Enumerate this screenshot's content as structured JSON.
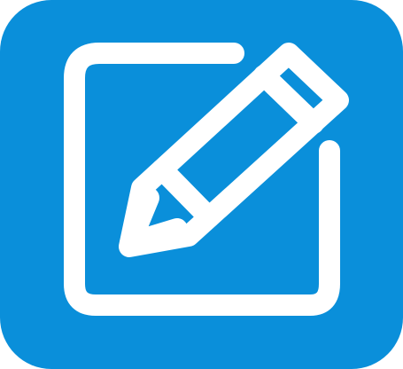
{
  "icon": {
    "name": "edit-icon",
    "background_color": "#0A8FDA",
    "glyph_color": "#FFFFFF",
    "glyph": "compose / pencil-on-square"
  }
}
